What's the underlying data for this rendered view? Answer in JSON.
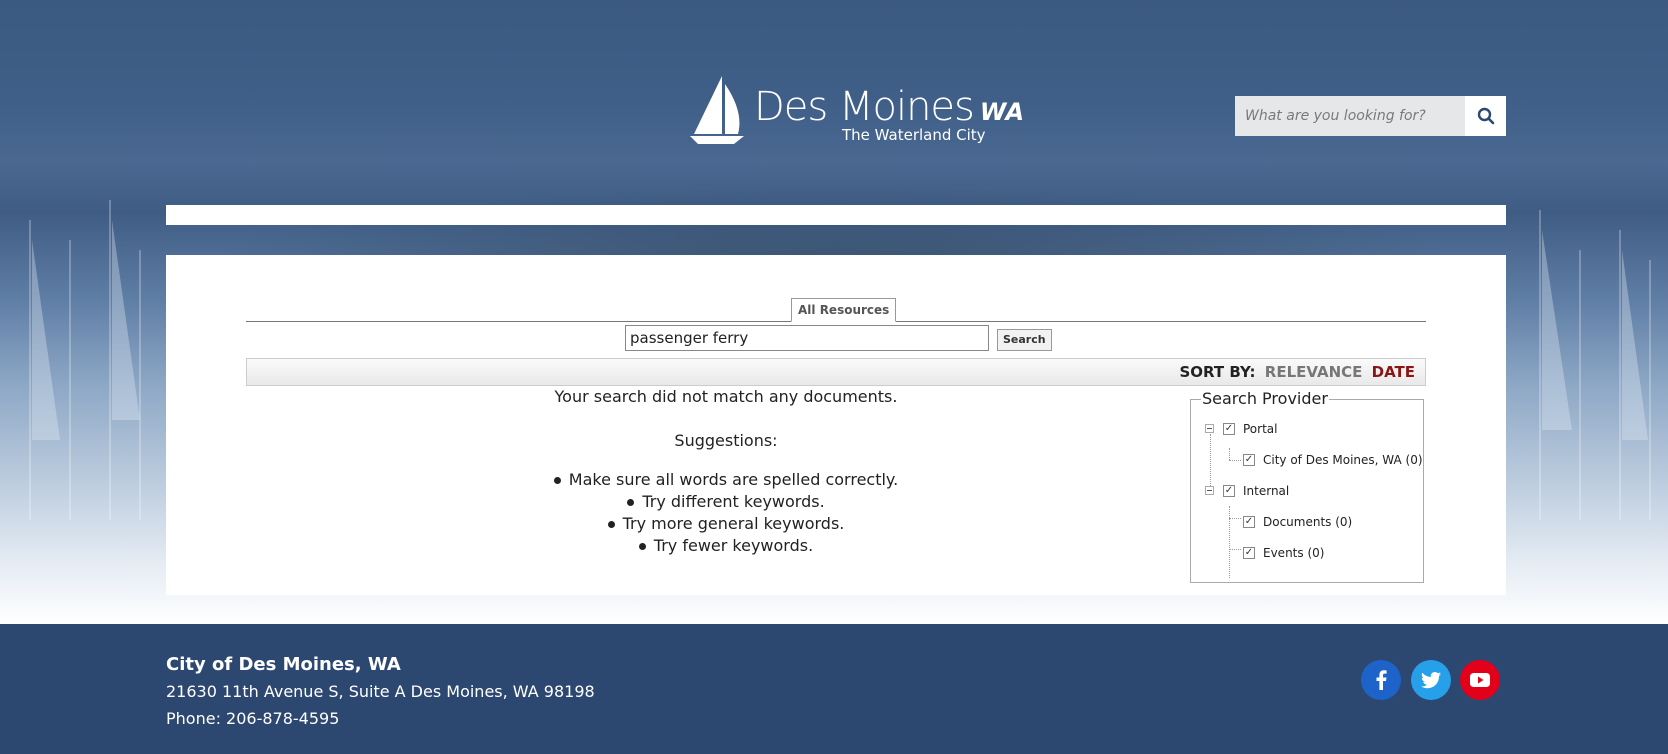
{
  "header": {
    "logo_name": "Des Moines",
    "logo_suffix": "WA",
    "logo_tagline": "The Waterland City",
    "search_placeholder": "What are you looking for?"
  },
  "search": {
    "tab_label": "All Resources",
    "query": "passenger ferry",
    "button_label": "Search",
    "sort_label": "SORT BY:",
    "sort_relevance": "RELEVANCE",
    "sort_date": "DATE"
  },
  "results": {
    "message": "Your search did not match any documents.",
    "suggestions_title": "Suggestions:",
    "suggestions": [
      "Make sure all words are spelled correctly.",
      "Try different keywords.",
      "Try more general keywords.",
      "Try fewer keywords."
    ]
  },
  "provider": {
    "title": "Search Provider",
    "portal": "Portal",
    "portal_city": "City of Des Moines, WA (0)",
    "internal": "Internal",
    "documents": "Documents (0)",
    "events": "Events (0)"
  },
  "footer": {
    "org": "City of Des Moines, WA",
    "address": "21630 11th Avenue S, Suite A Des Moines, WA 98198",
    "phone": "Phone: 206-878-4595"
  },
  "colors": {
    "header_blue": "#3b5a82",
    "footer_blue": "#2c4770",
    "sort_date": "#8a1515",
    "facebook": "#1e63c9",
    "twitter": "#27a0ea",
    "youtube": "#e2001a"
  },
  "icons": [
    "sailboat-logo-icon",
    "search-icon",
    "facebook-icon",
    "twitter-icon",
    "youtube-icon",
    "checkbox-icon",
    "tree-collapse-icon"
  ]
}
